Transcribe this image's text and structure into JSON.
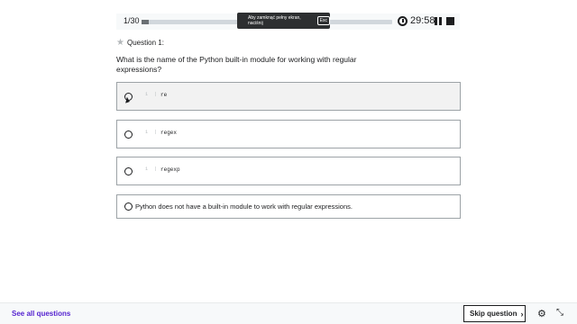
{
  "header": {
    "question_count": "1/30",
    "progress": 0.03,
    "fullscreen_toast": "Aby zamknąć pełny ekran, naciśnij",
    "fullscreen_key": "Esc",
    "timer": "29:58"
  },
  "question": {
    "label": "Question 1:",
    "text": "What is the name of the Python built-in module for working with regular expressions?"
  },
  "answers": [
    {
      "type": "code",
      "gutter": "1 | ",
      "text": "re",
      "state": "hover"
    },
    {
      "type": "code",
      "gutter": "1 | ",
      "text": "regex",
      "state": "normal"
    },
    {
      "type": "code",
      "gutter": "1 | ",
      "text": "regexp",
      "state": "normal"
    },
    {
      "type": "text",
      "text": "Python does not have a built-in module to work with regular expressions.",
      "state": "normal"
    }
  ],
  "footer": {
    "see_all": "See all questions",
    "skip": "Skip question",
    "skip_chevron": "›"
  },
  "icons": {
    "star": "star-icon",
    "timer": "timer-icon",
    "pause": "pause-icon",
    "stop": "stop-icon",
    "gear": "gear-icon",
    "collapse": "collapse-icon"
  },
  "colors": {
    "accent": "#5624d0",
    "text": "#1c1d1f",
    "border": "#9da3a7",
    "hover_bg": "#f2f2f2"
  }
}
